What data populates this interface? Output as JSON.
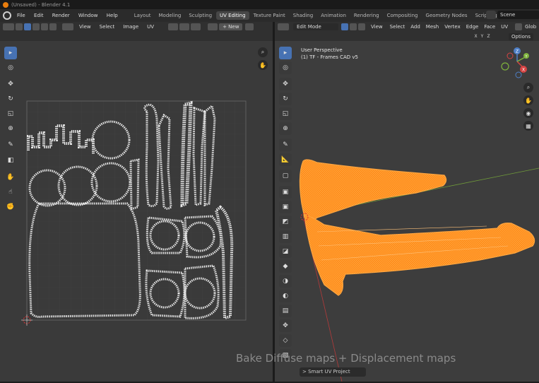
{
  "window": {
    "title": "(Unsaved) - Blender 4.1"
  },
  "menu": [
    "File",
    "Edit",
    "Render",
    "Window",
    "Help"
  ],
  "workspaces": {
    "items": [
      "Layout",
      "Modeling",
      "Sculpting",
      "UV Editing",
      "Texture Paint",
      "Shading",
      "Animation",
      "Rendering",
      "Compositing",
      "Geometry Nodes",
      "Scripting"
    ],
    "active": "UV Editing",
    "plus": "+"
  },
  "scene": {
    "label": "Scene"
  },
  "uv_editor": {
    "menus": [
      "View",
      "Select",
      "Image",
      "UV"
    ],
    "new_button": "+ New"
  },
  "viewport": {
    "mode": "Edit Mode",
    "menus": [
      "View",
      "Select",
      "Add",
      "Mesh",
      "Vertex",
      "Edge",
      "Face",
      "UV"
    ],
    "orientation": "Glob",
    "axes": [
      "X",
      "Y",
      "Z"
    ],
    "options": "Options",
    "perspective": "User Perspective",
    "object": "(1) TF - Frames CAD v5"
  },
  "gizmo": {
    "x": "X",
    "y": "Y",
    "z": "Z"
  },
  "overlay_text": "Bake Diffuse maps + Displacement maps",
  "operator_panel": "Smart UV Project",
  "colors": {
    "accent": "#4772b3",
    "mesh": "#ff8c1a",
    "background": "#3d3d3d"
  }
}
